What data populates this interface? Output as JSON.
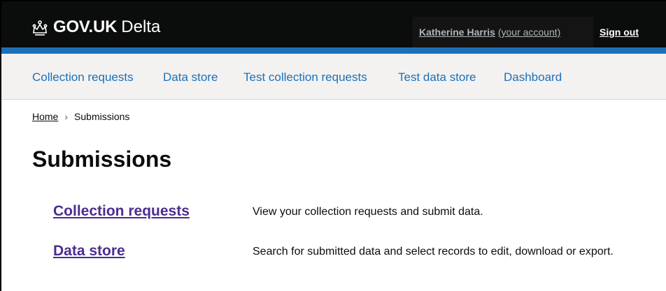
{
  "header": {
    "logo_text": "GOV.UK",
    "service_name": "Delta",
    "account_name": "Katherine Harris",
    "account_suffix": "(your account)",
    "sign_out": "Sign out",
    "colors": {
      "header_bg": "#0b0c0c",
      "accent_bar": "#1d70b8"
    }
  },
  "nav": {
    "items": [
      {
        "label": "Collection requests"
      },
      {
        "label": "Data store"
      },
      {
        "label": "Test collection requests"
      },
      {
        "label": "Test data store"
      },
      {
        "label": "Dashboard"
      }
    ],
    "link_color": "#1d70b8"
  },
  "breadcrumb": {
    "home": "Home",
    "separator": "›",
    "current": "Submissions"
  },
  "page": {
    "title": "Submissions"
  },
  "submissions": [
    {
      "link": "Collection requests",
      "description": "View your collection requests and submit data."
    },
    {
      "link": "Data store",
      "description": "Search for submitted data and select records to edit, download or export."
    }
  ],
  "icons": {
    "logo": "crown-icon",
    "breadcrumb_separator": "chevron-right-icon"
  },
  "colors": {
    "visited_link": "#4c2c92",
    "nav_bg": "#f3f2f1"
  }
}
